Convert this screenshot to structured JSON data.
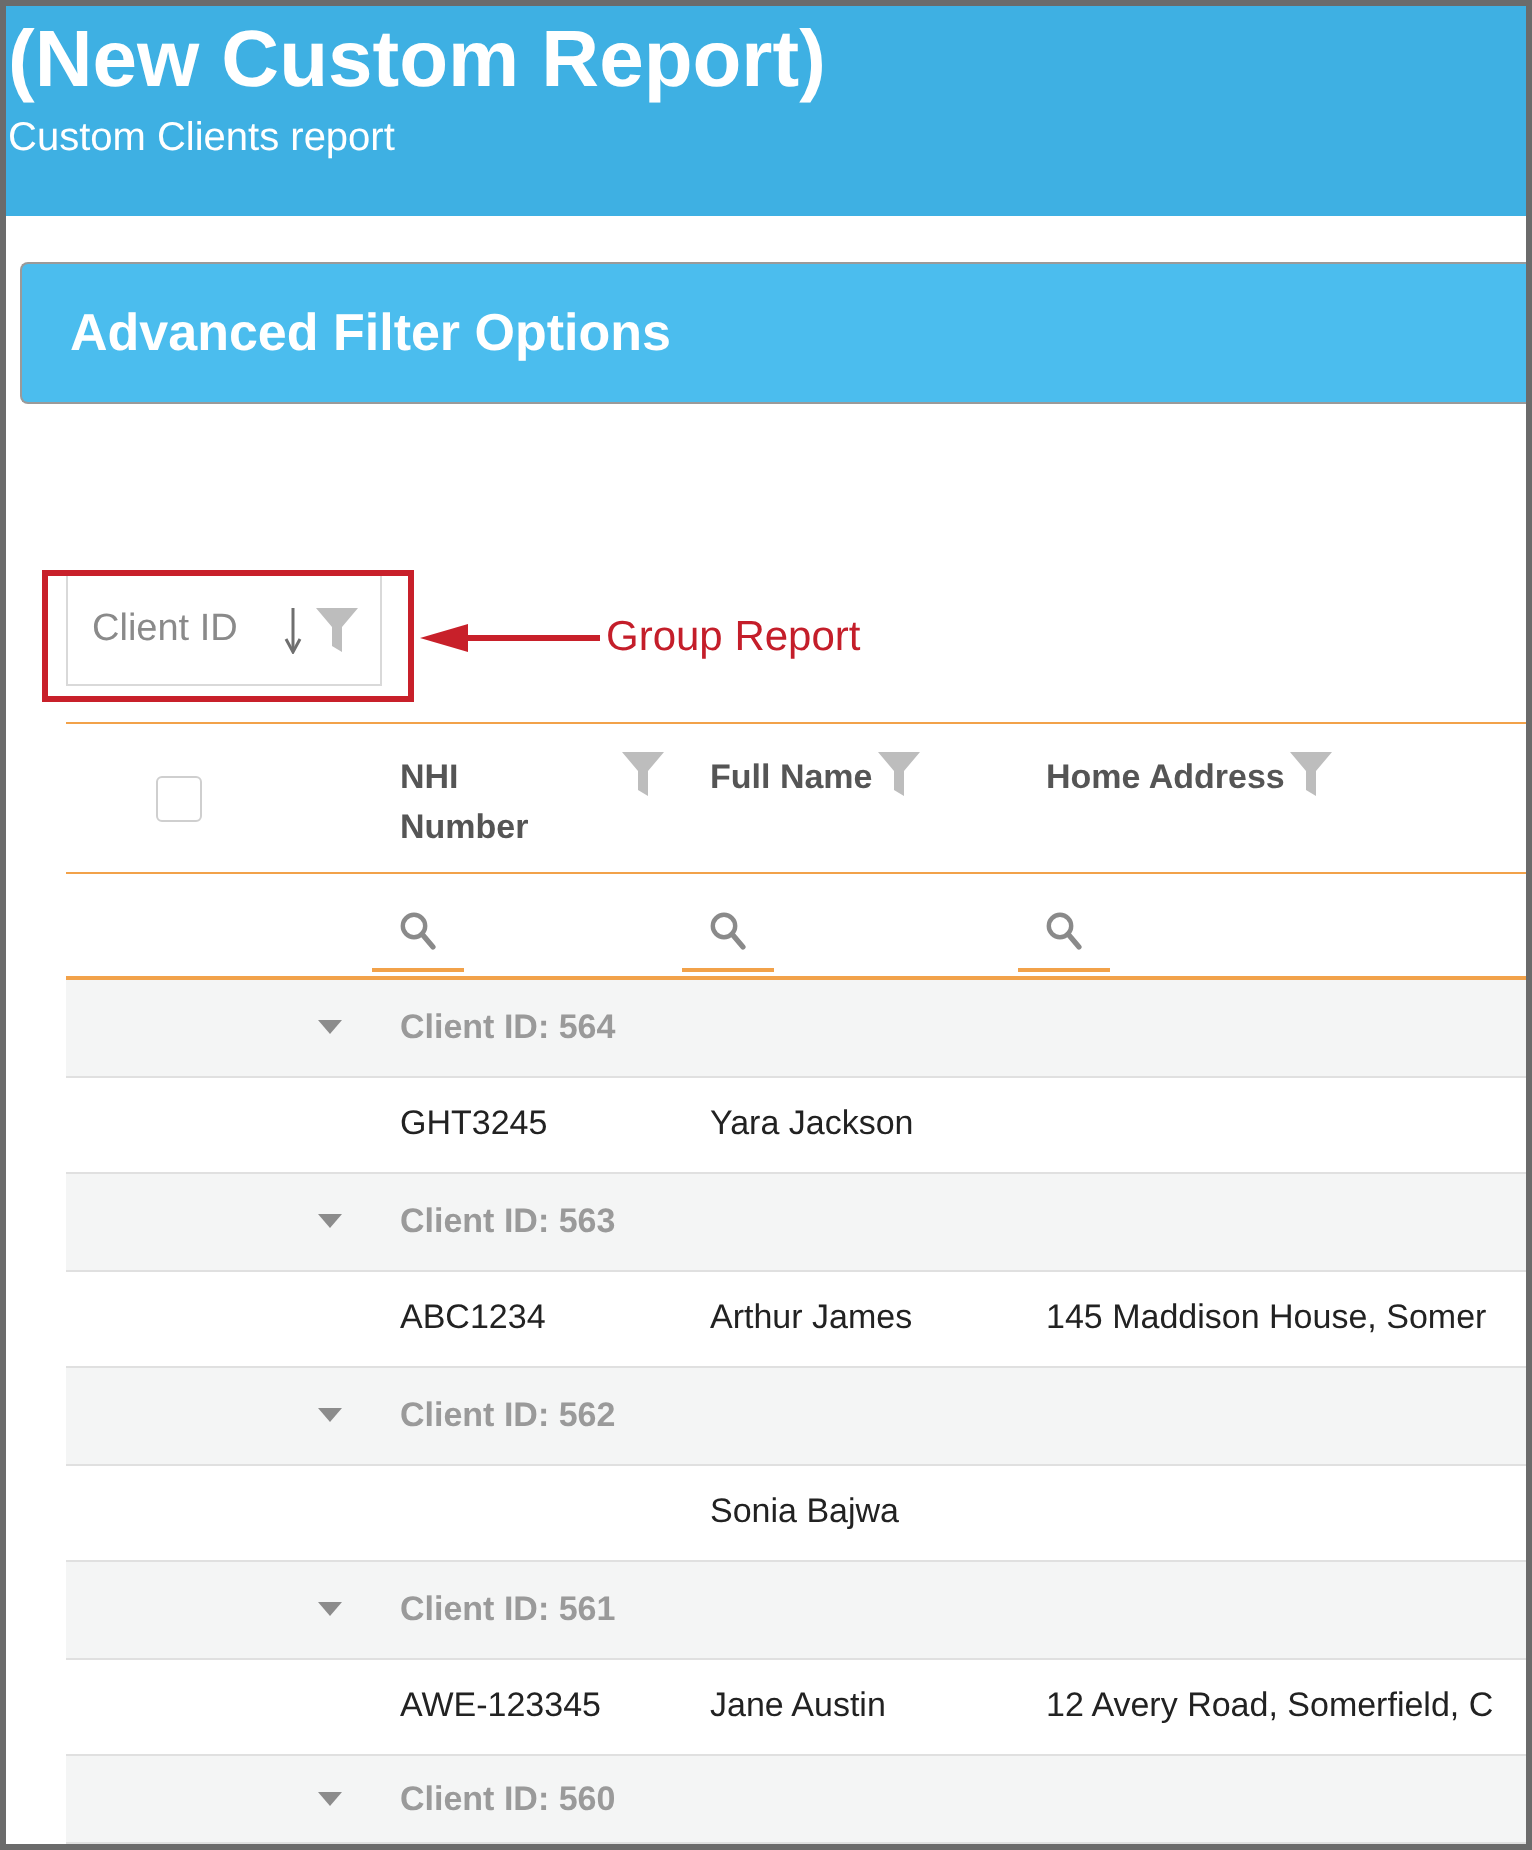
{
  "header": {
    "title": "(New Custom Report)",
    "subtitle": "Custom Clients report"
  },
  "filter_panel": {
    "title": "Advanced Filter Options"
  },
  "group_panel": {
    "chips": [
      {
        "label": "Client ID",
        "descending": true
      }
    ],
    "annotation": {
      "label": "Group Report"
    }
  },
  "table": {
    "select_all": {
      "checked": false
    },
    "columns": [
      {
        "label": "NHI Number"
      },
      {
        "label": "Full Name"
      },
      {
        "label": "Home Address"
      }
    ],
    "groups": [
      {
        "label": "Client ID: 564",
        "expanded": true,
        "rows": [
          {
            "nhi_number": "GHT3245",
            "full_name": "Yara Jackson"
          }
        ]
      },
      {
        "label": "Client ID: 563",
        "expanded": true,
        "rows": [
          {
            "nhi_number": "ABC1234",
            "full_name": "Arthur James",
            "home_address": "145 Maddison House, Somer"
          }
        ]
      },
      {
        "label": "Client ID: 562",
        "expanded": true,
        "rows": [
          {
            "full_name": "Sonia Bajwa"
          }
        ]
      },
      {
        "label": "Client ID: 561",
        "expanded": true,
        "rows": [
          {
            "nhi_number": "AWE-123345",
            "full_name": "Jane Austin",
            "home_address": "12 Avery Road, Somerfield, C"
          }
        ]
      },
      {
        "label": "Client ID: 560",
        "expanded": true
      }
    ]
  }
}
